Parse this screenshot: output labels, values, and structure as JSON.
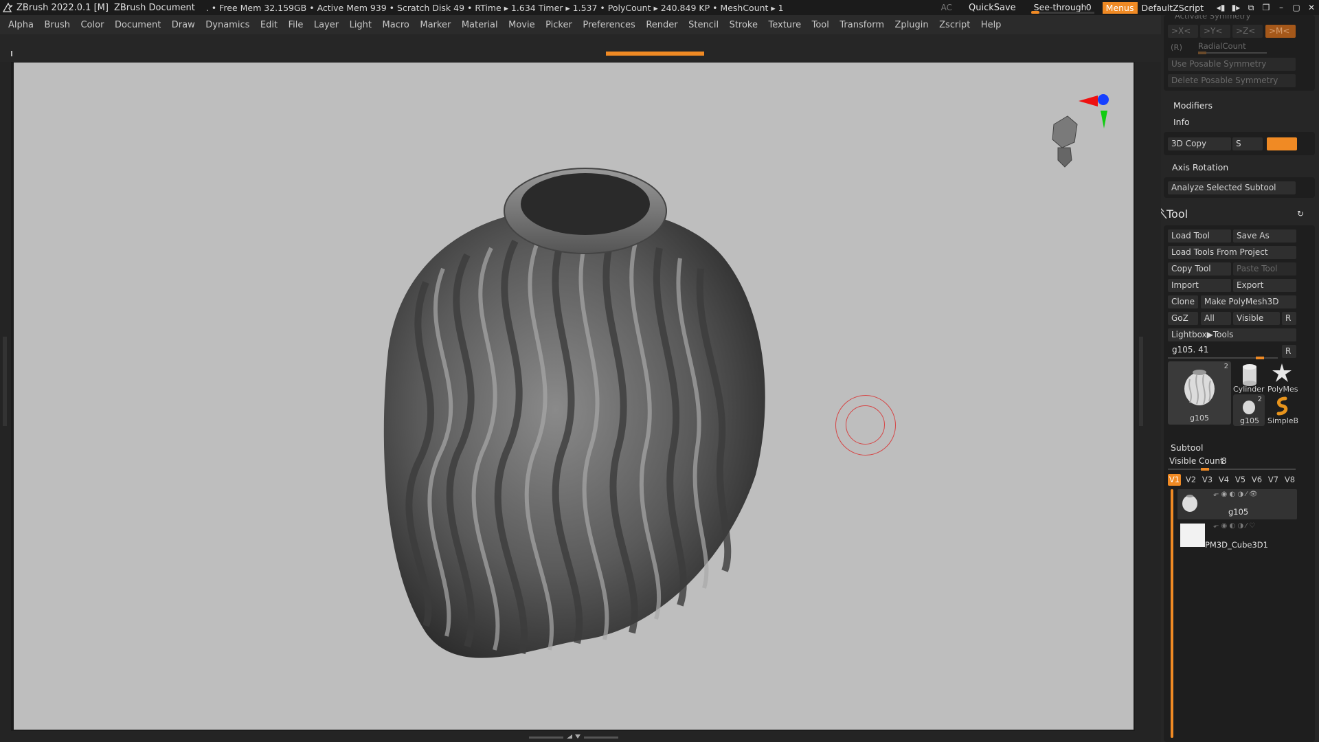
{
  "titlebar": {
    "app": "ZBrush 2022.0.1 [M]",
    "document": "ZBrush Document",
    "stats": ". • Free Mem 32.159GB • Active Mem 939 • Scratch Disk 49 •  RTime ▸ 1.634 Timer ▸ 1.537 • PolyCount ▸ 240.849 KP  • MeshCount ▸ 1",
    "ac": "AC",
    "quicksave": "QuickSave",
    "seethrough_label": "See-through",
    "seethrough_value": "0",
    "menus": "Menus",
    "default_zscript": "DefaultZScript"
  },
  "menubar": [
    "Alpha",
    "Brush",
    "Color",
    "Document",
    "Draw",
    "Dynamics",
    "Edit",
    "File",
    "Layer",
    "Light",
    "Macro",
    "Marker",
    "Material",
    "Movie",
    "Picker",
    "Preferences",
    "Render",
    "Stencil",
    "Stroke",
    "Texture",
    "Tool",
    "Transform",
    "Zplugin",
    "Zscript",
    "Help"
  ],
  "symmetry": {
    "heading": "Activate Symmetry",
    "x": ">X<",
    "y": ">Y<",
    "z": ">Z<",
    "m": ">M<",
    "r": "(R)",
    "radial": "RadialCount",
    "use_posable": "Use Posable Symmetry",
    "delete_posable": "Delete Posable Symmetry"
  },
  "modifiers": {
    "modifiers": "Modifiers",
    "info": "Info",
    "copy3d": "3D Copy",
    "s": "S",
    "axis_rotation": "Axis Rotation",
    "analyze": "Analyze Selected Subtool"
  },
  "tool": {
    "title": "Tool",
    "load_tool": "Load Tool",
    "save_as": "Save As",
    "load_from_project": "Load Tools From Project",
    "copy_tool": "Copy Tool",
    "paste_tool": "Paste Tool",
    "import": "Import",
    "export": "Export",
    "clone": "Clone",
    "make_polymesh": "Make PolyMesh3D",
    "goz": "GoZ",
    "all": "All",
    "visible": "Visible",
    "r": "R",
    "lightbox_tools": "Lightbox▶Tools",
    "current_tool": "g105. 41",
    "r2": "R",
    "thumbs": [
      {
        "label": "g105",
        "count": "2"
      },
      {
        "label": "Cylinder",
        "count": ""
      },
      {
        "label": "PolyMes",
        "count": ""
      },
      {
        "label": "g105",
        "count": "2"
      },
      {
        "label": "SimpleB",
        "count": ""
      }
    ]
  },
  "subtool": {
    "title": "Subtool",
    "visible_count_label": "Visible Count",
    "visible_count": "8",
    "tabs": [
      "V1",
      "V2",
      "V3",
      "V4",
      "V5",
      "V6",
      "V7",
      "V8"
    ],
    "items": [
      {
        "name": "g105"
      },
      {
        "name": "PM3D_Cube3D1"
      }
    ]
  }
}
